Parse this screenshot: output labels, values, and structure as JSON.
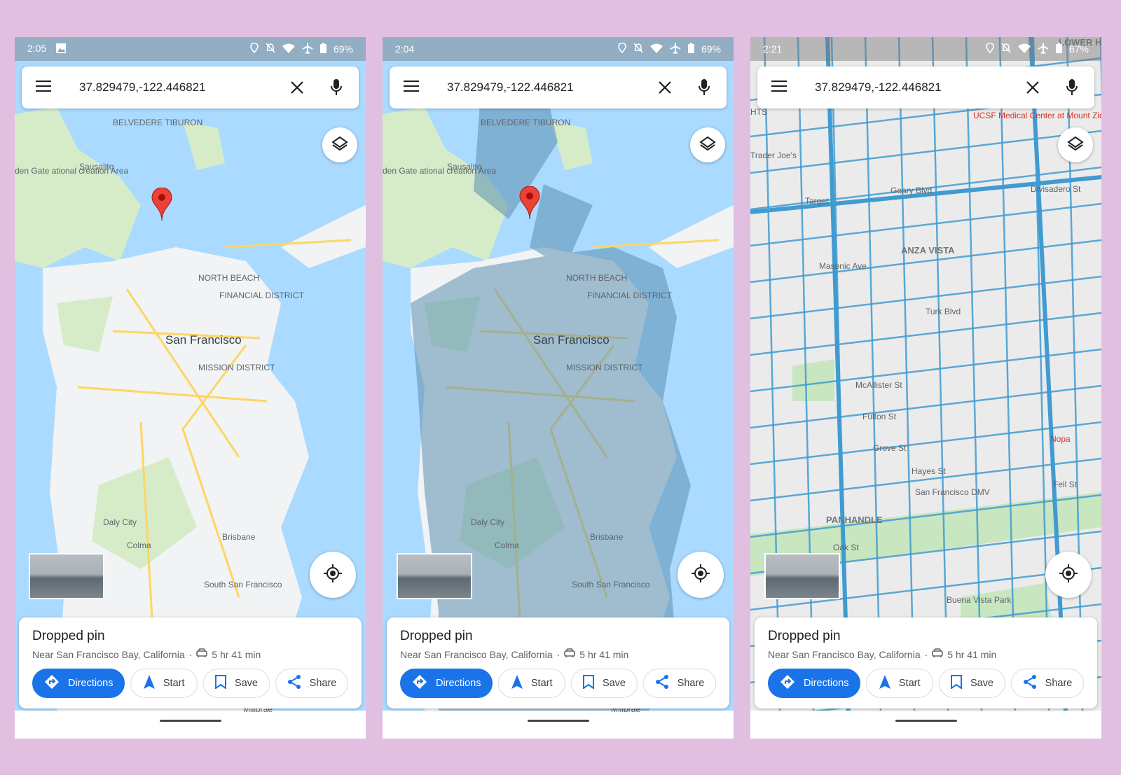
{
  "phones": [
    {
      "status": {
        "time": "2:05",
        "battery": "69%",
        "extra_icon": "image-icon"
      },
      "search": {
        "query": "37.829479,-122.446821"
      },
      "map_style": "default",
      "labels": [
        "Sausalito",
        "BELVEDERE TIBURON",
        "den Gate ational creation Area",
        "NORTH BEACH",
        "FINANCIAL DISTRICT",
        "San Francisco",
        "MISSION DISTRICT",
        "Daly City",
        "Colma",
        "Brisbane",
        "South San Francisco",
        "Millbrae"
      ],
      "card": {
        "title": "Dropped pin",
        "subtitle": "Near San Francisco Bay, California",
        "drive_time": "5 hr 41 min",
        "buttons": {
          "directions": "Directions",
          "start": "Start",
          "save": "Save",
          "share": "Share"
        }
      }
    },
    {
      "status": {
        "time": "2:04",
        "battery": "69%"
      },
      "search": {
        "query": "37.829479,-122.446821"
      },
      "map_style": "coverage overlay",
      "labels": [
        "Sausalito",
        "BELVEDERE TIBURON",
        "den Gate ational creation Area",
        "NORTH BEACH",
        "FINANCIAL DISTRICT",
        "San Francisco",
        "MISSION DISTRICT",
        "Daly City",
        "Colma",
        "Brisbane",
        "South San Francisco",
        "Millbrae"
      ],
      "card": {
        "title": "Dropped pin",
        "subtitle": "Near San Francisco Bay, California",
        "drive_time": "5 hr 41 min",
        "buttons": {
          "directions": "Directions",
          "start": "Start",
          "save": "Save",
          "share": "Share"
        }
      }
    },
    {
      "status": {
        "time": "2:21",
        "battery": "67%"
      },
      "search": {
        "query": "37.829479,-122.446821"
      },
      "map_style": "street detail",
      "labels": [
        "UCSF Medical Center at Mount Zion",
        "Trader Joe's",
        "Target",
        "Geary Blvd",
        "ANZA VISTA",
        "Turk Blvd",
        "McAllister St",
        "Fulton St",
        "Grove St",
        "Hayes St",
        "San Francisco DMV",
        "PANHANDLE",
        "Oak St",
        "Fell St",
        "Nopa",
        "Buena Vista Park",
        "Masonic Ave",
        "Divisadero St",
        "HTS",
        "LOWER HE"
      ],
      "card": {
        "title": "Dropped pin",
        "subtitle": "Near San Francisco Bay, California",
        "drive_time": "5 hr 41 min",
        "buttons": {
          "directions": "Directions",
          "start": "Start",
          "save": "Save",
          "share": "Share"
        }
      }
    }
  ],
  "colors": {
    "water": "#aadaff",
    "land": "#f1f3f4",
    "park": "#c8e6c0",
    "accent": "#1a73e8",
    "pin": "#ea4335",
    "coverage": "#5b8fb0",
    "street_overlay": "#3f9bd1",
    "background": "#e1bfe0"
  }
}
